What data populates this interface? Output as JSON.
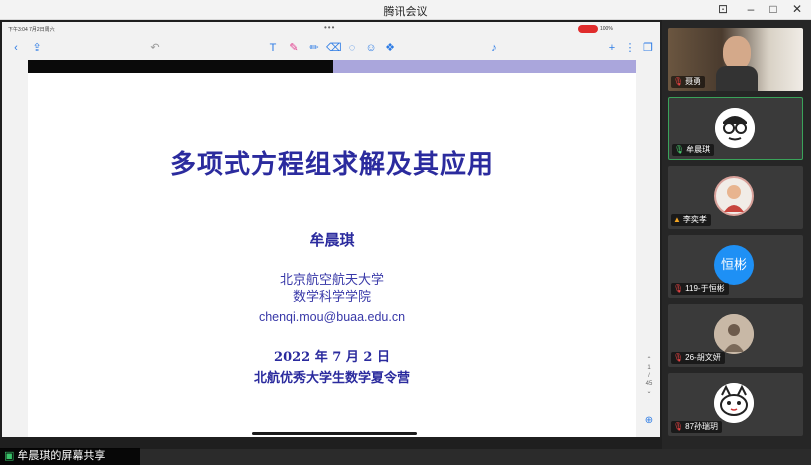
{
  "window": {
    "title": "腾讯会议"
  },
  "status_bar": {
    "left": "下午3:04  7月2日周六",
    "right": "100%",
    "dots": "•••"
  },
  "slide": {
    "title": "多项式方程组求解及其应用",
    "author": "牟晨琪",
    "affiliation_1": "北京航空航天大学",
    "affiliation_2": "数学科学学院",
    "email": "chenqi.mou@buaa.edu.cn",
    "date": "2022 年 7 月 2 日",
    "event": "北航优秀大学生数学夏令营"
  },
  "pager": {
    "current": "1",
    "total": "45"
  },
  "share_banner": {
    "text": "牟晨琪的屏幕共享"
  },
  "participants": [
    {
      "name": "聂勇",
      "mic": "muted"
    },
    {
      "name": "牟晨琪",
      "mic": "on"
    },
    {
      "name": "李奕孝",
      "mic": "muted"
    },
    {
      "name": "119-于恒彬",
      "mic": "muted",
      "avatar_text": "恒彬"
    },
    {
      "name": "26-胡文妍",
      "mic": "muted"
    },
    {
      "name": "87孙瑞玥",
      "mic": "muted"
    }
  ],
  "colors": {
    "slide_text": "#2b2b9e",
    "slide_bar_right": "#aaa6dc",
    "accent": "#2c7be5",
    "active_border": "#3aa35a"
  }
}
